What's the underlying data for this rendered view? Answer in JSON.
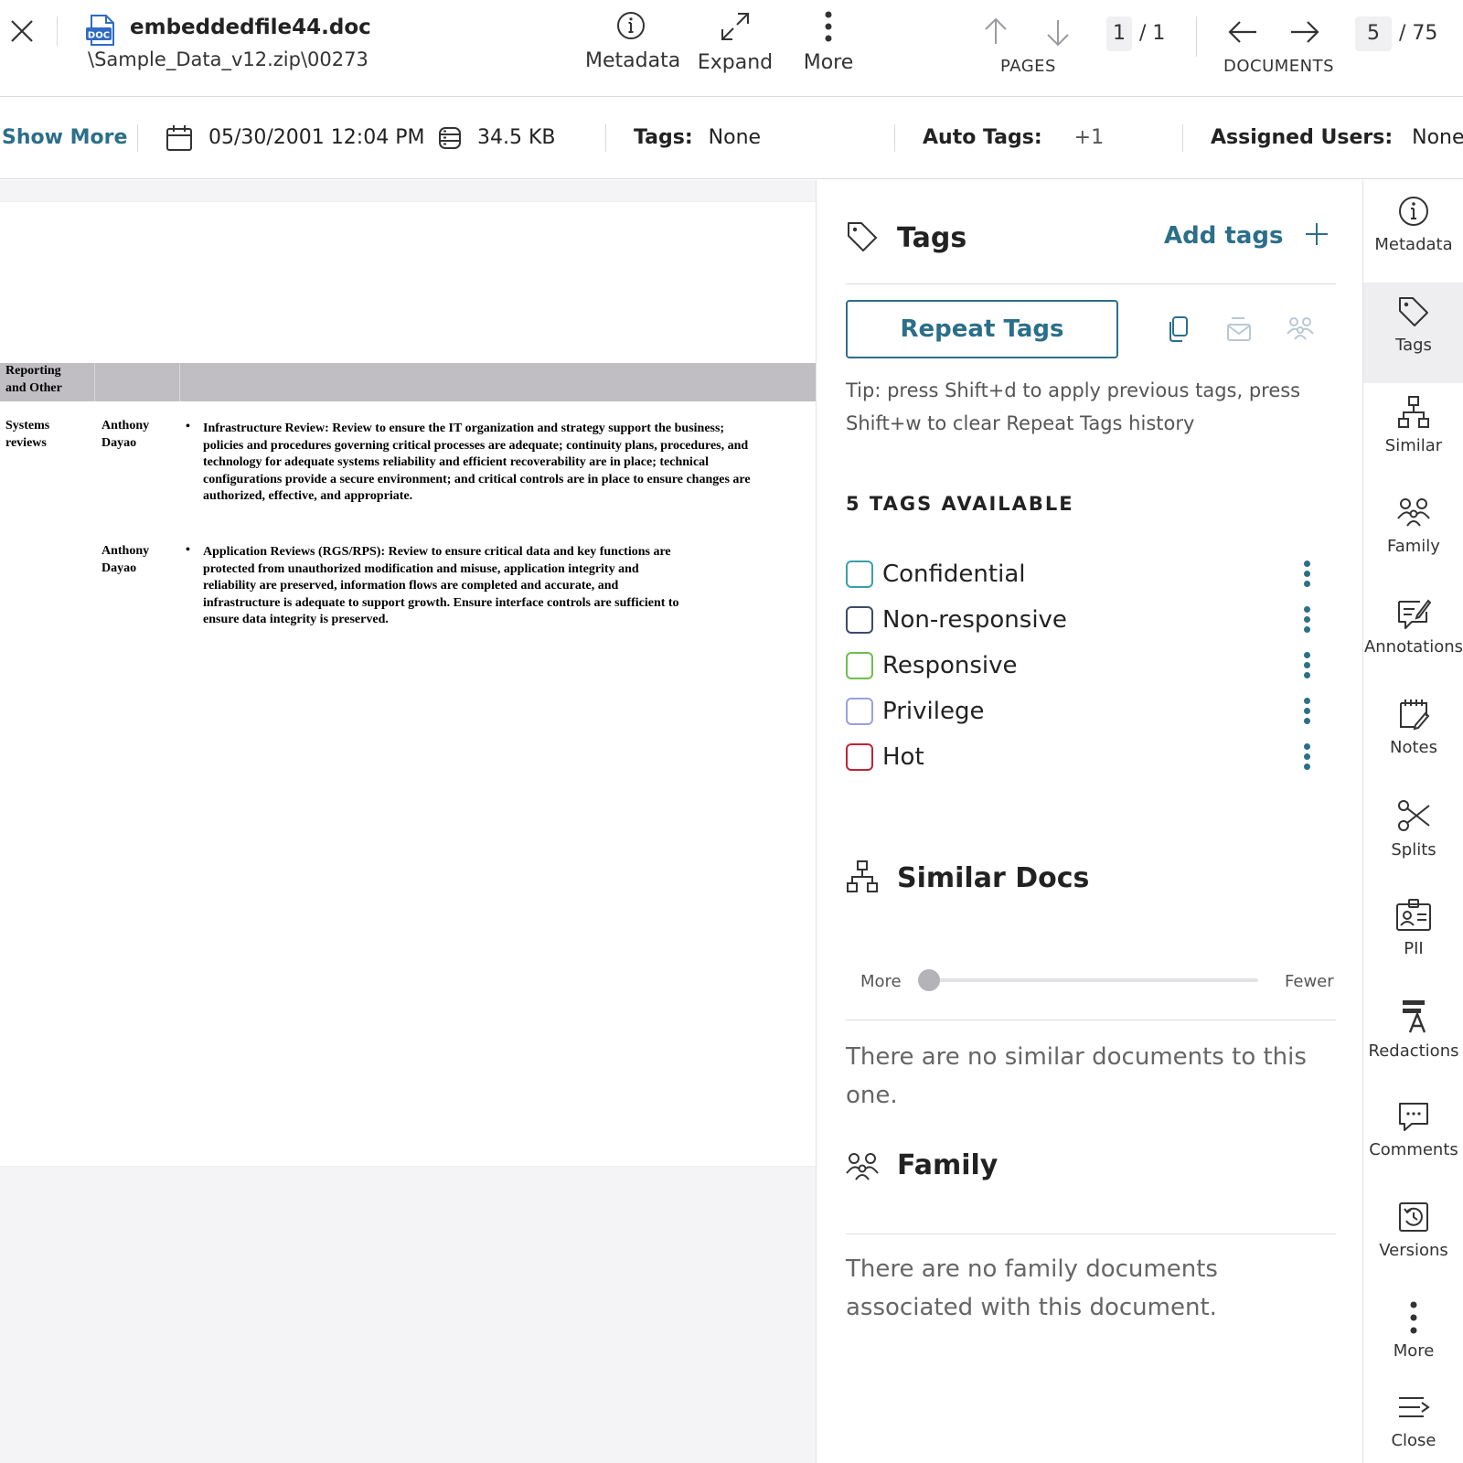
{
  "header": {
    "file_name": "embeddedfile44.doc",
    "file_path": "\\Sample_Data_v12.zip\\00273",
    "doc_badge": "DOC",
    "tools": {
      "metadata": "Metadata",
      "expand": "Expand",
      "more": "More"
    },
    "pages": {
      "caption": "PAGES",
      "current": "1",
      "total": "/ 1"
    },
    "documents": {
      "caption": "DOCUMENTS",
      "current": "5",
      "total": "/ 75"
    }
  },
  "infobar": {
    "show_more": "Show More",
    "date": "05/30/2001 12:04 PM",
    "size": "34.5 KB",
    "tags_label": "Tags:",
    "tags_value": "None",
    "auto_tags_label": "Auto Tags:",
    "auto_tags_value": "+1",
    "assigned_label": "Assigned Users:",
    "assigned_value": "None"
  },
  "document": {
    "band_label_1": "Reporting",
    "band_label_2": "and Other",
    "row1": {
      "col1_a": "Systems",
      "col1_b": "reviews",
      "col2_a": "Anthony",
      "col2_b": "Dayao",
      "lines": [
        "Infrastructure Review: Review to ensure the IT organization and strategy support the business;",
        "policies and procedures governing critical processes are adequate; continuity plans, procedures, and",
        "technology for adequate systems reliability and efficient recoverability are in place; technical",
        "configurations provide a secure environment; and critical controls are in place to ensure changes are",
        "authorized, effective, and appropriate."
      ]
    },
    "row2": {
      "col2_a": "Anthony",
      "col2_b": "Dayao",
      "lines": [
        "Application Reviews (RGS/RPS): Review to ensure critical data and key functions are",
        "protected from unauthorized modification and misuse, application integrity and",
        "reliability are preserved, information flows are completed and accurate, and",
        "infrastructure is adequate to support growth.  Ensure interface controls are sufficient to",
        "ensure data integrity is preserved."
      ]
    },
    "bullet": "•"
  },
  "tags_panel": {
    "title": "Tags",
    "add_tags": "Add tags",
    "repeat_tags": "Repeat Tags",
    "tip": "Tip: press Shift+d to apply previous tags, press Shift+w to clear Repeat Tags history",
    "available": "5 TAGS AVAILABLE",
    "tags": [
      {
        "label": "Confidential",
        "color": "#3a9fa8"
      },
      {
        "label": "Non-responsive",
        "color": "#3f4a6a"
      },
      {
        "label": "Responsive",
        "color": "#6cc04a"
      },
      {
        "label": "Privilege",
        "color": "#9aa0e0"
      },
      {
        "label": "Hot",
        "color": "#c0243a"
      }
    ]
  },
  "similar_docs": {
    "title": "Similar Docs",
    "slider_more": "More",
    "slider_fewer": "Fewer",
    "slider_value": 0,
    "empty": "There are no similar documents to this one."
  },
  "family": {
    "title": "Family",
    "empty": "There are no family documents associated with this document."
  },
  "rail": {
    "metadata": "Metadata",
    "tags": "Tags",
    "similar": "Similar",
    "family": "Family",
    "annotations": "Annotations",
    "notes": "Notes",
    "splits": "Splits",
    "pii": "PII",
    "redactions": "Redactions",
    "comments": "Comments",
    "versions": "Versions",
    "more": "More",
    "close": "Close"
  },
  "colors": {
    "accent": "#2b6f8a",
    "band": "#c0bec3",
    "viewer_bg": "#f4f4f6"
  }
}
